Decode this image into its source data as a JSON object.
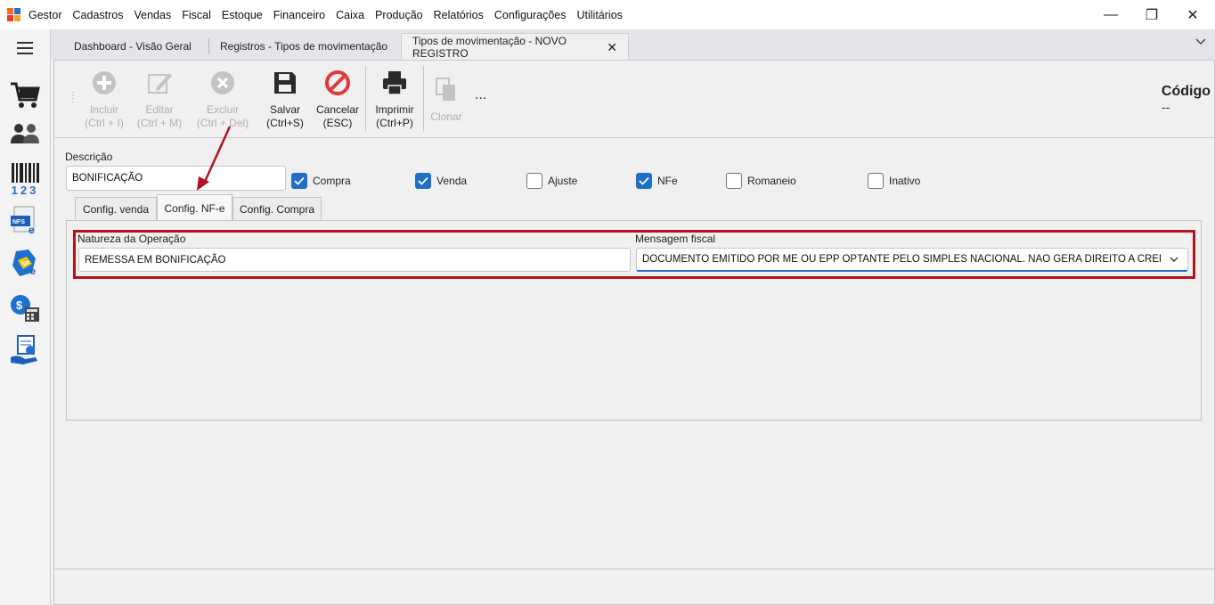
{
  "menubar": {
    "items": [
      "Gestor",
      "Cadastros",
      "Vendas",
      "Fiscal",
      "Estoque",
      "Financeiro",
      "Caixa",
      "Produção",
      "Relatórios",
      "Configurações",
      "Utilitários"
    ],
    "window_controls": {
      "minimize": "—",
      "maximize": "❐",
      "close": "✕"
    }
  },
  "sidebar": {
    "icons": [
      "menu-icon",
      "cart-icon",
      "people-icon",
      "barcode-icon",
      "nfse-icon",
      "nfe-icon",
      "money-calculator-icon",
      "receipt-hand-icon"
    ],
    "barcode_digits": "123"
  },
  "tabs": [
    {
      "label": "Dashboard - Visão Geral"
    },
    {
      "label": "Registros - Tipos de movimentação"
    },
    {
      "label": "Tipos de movimentação - NOVO REGISTRO",
      "close": "✕"
    }
  ],
  "toolbar": {
    "incluir": {
      "label": "Incluir",
      "shortcut": "(Ctrl + I)"
    },
    "editar": {
      "label": "Editar",
      "shortcut": "(Ctrl + M)"
    },
    "excluir": {
      "label": "Excluir",
      "shortcut": "(Ctrl + Del)"
    },
    "salvar": {
      "label": "Salvar",
      "shortcut": "(Ctrl+S)"
    },
    "cancelar": {
      "label": "Cancelar",
      "shortcut": "(ESC)"
    },
    "imprimir": {
      "label": "Imprimir",
      "shortcut": "(Ctrl+P)"
    },
    "clonar": {
      "label": "Clonar"
    },
    "more": "..."
  },
  "codigo": {
    "label": "Código",
    "value": "--"
  },
  "form": {
    "descricao_label": "Descrição",
    "descricao_value": "BONIFICAÇÃO",
    "checkboxes": [
      {
        "label": "Compra",
        "checked": true
      },
      {
        "label": "Venda",
        "checked": true
      },
      {
        "label": "Ajuste",
        "checked": false
      },
      {
        "label": "NFe",
        "checked": true
      },
      {
        "label": "Romaneio",
        "checked": false
      },
      {
        "label": "Inativo",
        "checked": false
      }
    ],
    "subtabs": [
      "Config. venda",
      "Config. NF-e",
      "Config. Compra"
    ],
    "natureza_label": "Natureza da Operação",
    "natureza_value": "REMESSA EM BONIFICAÇÃO",
    "mensagem_label": "Mensagem fiscal",
    "mensagem_value": "DOCUMENTO EMITIDO POR ME OU EPP OPTANTE PELO SIMPLES NACIONAL. NÃO GERA DIREITO A CRÉDITO FISCAL D..."
  },
  "colors": {
    "accent": "#1f6fc5",
    "highlight": "#b0131e",
    "cancel": "#e03a3a"
  }
}
